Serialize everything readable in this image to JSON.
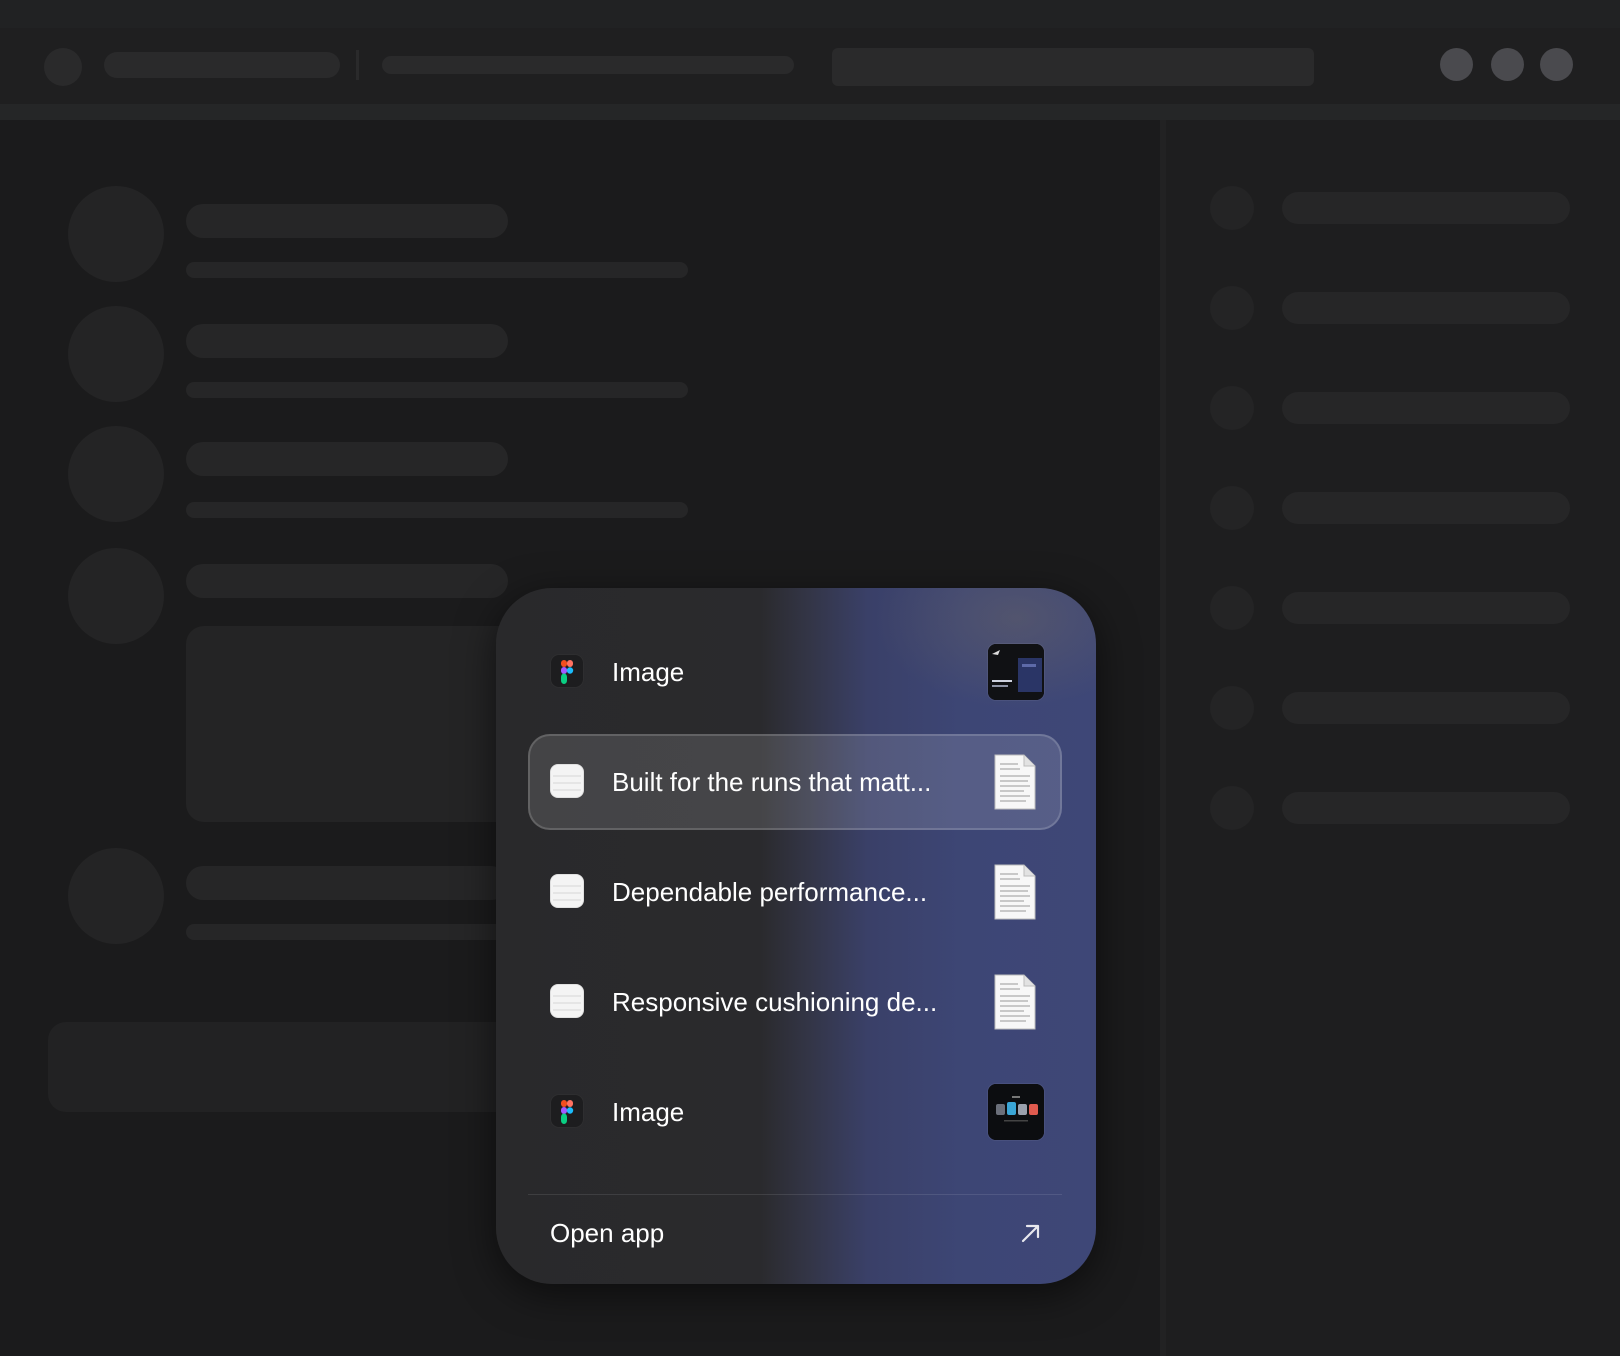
{
  "popup": {
    "items": [
      {
        "app_icon": "figma-icon",
        "label": "Image",
        "thumbnail": "image-thumbnail"
      },
      {
        "app_icon": "notes-icon",
        "label": "Built for the runs that matt...",
        "thumbnail": "document-thumbnail",
        "selected": true
      },
      {
        "app_icon": "notes-icon",
        "label": "Dependable performance...",
        "thumbnail": "document-thumbnail"
      },
      {
        "app_icon": "notes-icon",
        "label": "Responsive cushioning de...",
        "thumbnail": "document-thumbnail"
      },
      {
        "app_icon": "figma-icon",
        "label": "Image",
        "thumbnail": "image-thumbnail"
      }
    ],
    "open_app_label": "Open app",
    "open_app_icon": "arrow-up-right-icon"
  },
  "colors": {
    "background": "#1b1b1c",
    "popup_left": "#29292b",
    "popup_right": "#3e4777",
    "text": "#ffffff"
  }
}
